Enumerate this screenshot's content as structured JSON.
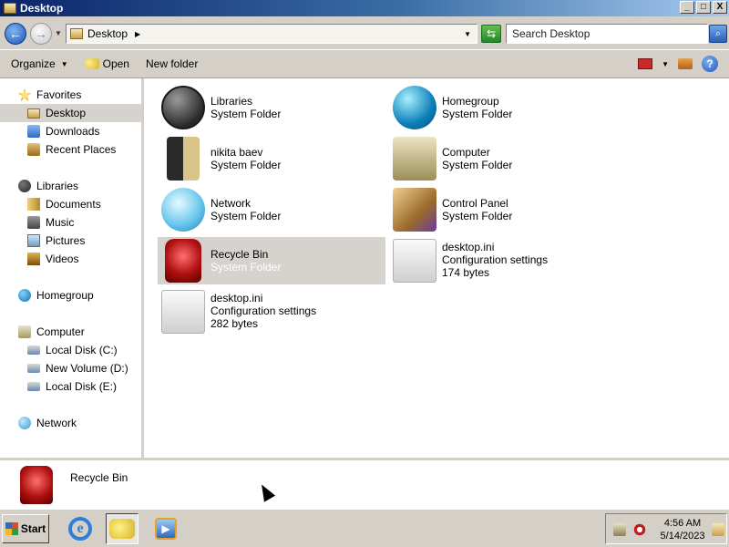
{
  "window": {
    "title": "Desktop"
  },
  "titlebar": {
    "buttons": [
      "_",
      "□",
      "X"
    ]
  },
  "address": {
    "location": "Desktop",
    "search_placeholder": "Search Desktop"
  },
  "commands": {
    "organize": "Organize",
    "open": "Open",
    "new_folder": "New folder"
  },
  "sidebar": {
    "favorites": "Favorites",
    "fav_items": [
      "Desktop",
      "Downloads",
      "Recent Places"
    ],
    "libraries": "Libraries",
    "lib_items": [
      "Documents",
      "Music",
      "Pictures",
      "Videos"
    ],
    "homegroup": "Homegroup",
    "computer": "Computer",
    "drives": [
      "Local Disk (C:)",
      "New Volume (D:)",
      "Local Disk (E:)"
    ],
    "network": "Network",
    "selected": "Desktop"
  },
  "items": [
    {
      "name": "Libraries",
      "type": "System Folder",
      "icon": "libraries-icon"
    },
    {
      "name": "Homegroup",
      "type": "System Folder",
      "icon": "homegroup-icon"
    },
    {
      "name": "nikita baev",
      "type": "System Folder",
      "icon": "user-folder-icon"
    },
    {
      "name": "Computer",
      "type": "System Folder",
      "icon": "computer-icon"
    },
    {
      "name": "Network",
      "type": "System Folder",
      "icon": "network-icon"
    },
    {
      "name": "Control Panel",
      "type": "System Folder",
      "icon": "control-panel-icon"
    },
    {
      "name": "Recycle Bin",
      "type": "System Folder",
      "icon": "recycle-bin-icon",
      "selected": true
    },
    {
      "name": "desktop.ini",
      "type": "Configuration settings",
      "size": "174 bytes",
      "icon": "ini-file-icon"
    },
    {
      "name": "desktop.ini",
      "type": "Configuration settings",
      "size": "282 bytes",
      "icon": "ini-file-icon"
    }
  ],
  "details": {
    "name": "Recycle Bin"
  },
  "taskbar": {
    "start": "Start",
    "time": "4:56 AM",
    "date": "5/14/2023"
  },
  "colors": {
    "selection": "#d6d3ce",
    "chrome": "#d4d0c8",
    "title_start": "#0a246a",
    "title_end": "#a6caf0"
  }
}
